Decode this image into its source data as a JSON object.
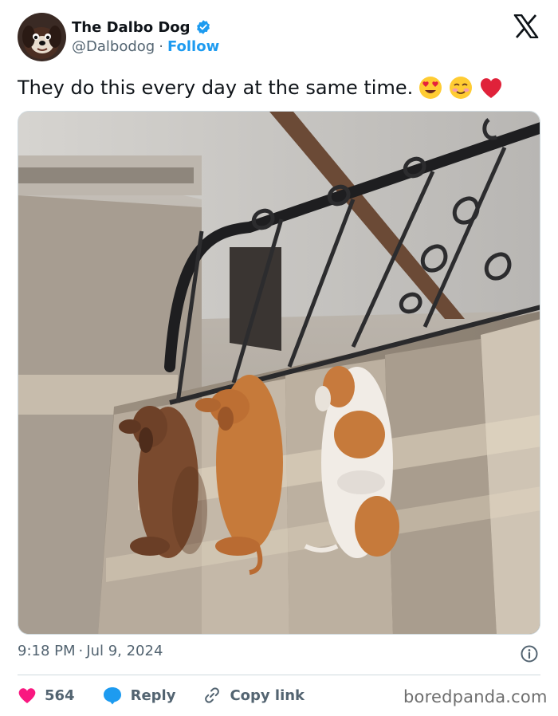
{
  "author": {
    "display_name": "The Dalbo Dog",
    "handle": "@Dalbodog",
    "separator": "·",
    "follow_label": "Follow"
  },
  "tweet": {
    "text": "They do this every day at the same time.",
    "emojis": [
      "heart-eyes-emoji",
      "smiling-blush-emoji",
      "red-heart-emoji"
    ]
  },
  "meta": {
    "time": "9:18 PM",
    "separator": "·",
    "date": "Jul 9, 2024"
  },
  "actions": {
    "likes_count": "564",
    "reply_label": "Reply",
    "copy_link_label": "Copy link"
  },
  "watermark": "boredpanda.com",
  "colors": {
    "accent": "#1d9bf0",
    "like": "#f91880",
    "text": "#0f1419",
    "muted": "#536471"
  }
}
